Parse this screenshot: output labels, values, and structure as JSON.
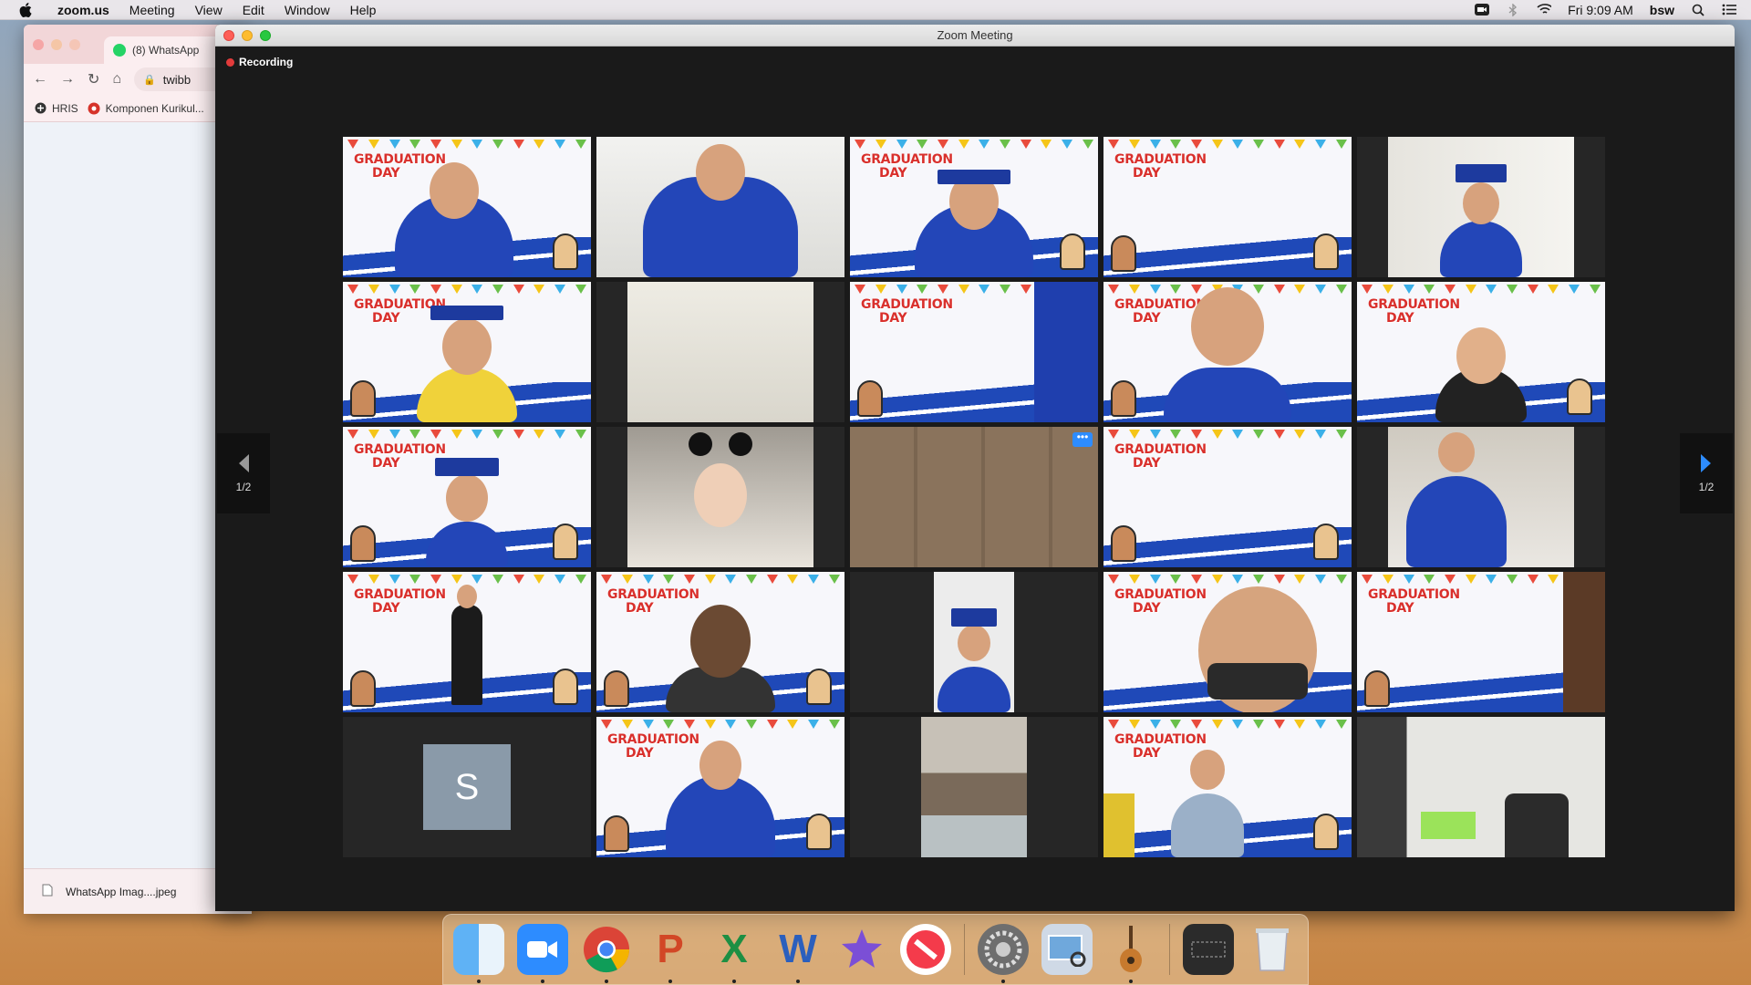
{
  "menubar": {
    "app_name": "zoom.us",
    "menus": [
      "Meeting",
      "View",
      "Edit",
      "Window",
      "Help"
    ],
    "clock": "Fri 9:09 AM",
    "user": "bsw"
  },
  "chrome": {
    "tab_title": "(8) WhatsApp",
    "address": "twibb",
    "bookmarks": [
      "HRIS",
      "Komponen Kurikul..."
    ],
    "download_file": "WhatsApp Imag....jpeg"
  },
  "zoom": {
    "window_title": "Zoom Meeting",
    "recording_label": "Recording",
    "page_indicator_left": "1/2",
    "page_indicator_right": "1/2",
    "graduation_text_1": "GRADUATION",
    "graduation_text_2": "DAY",
    "avatar_initial": "S",
    "more_label": "•••"
  },
  "dock": {
    "apps": [
      "finder",
      "zoom",
      "chrome",
      "powerpoint",
      "excel",
      "word",
      "imovie",
      "news",
      "system-preferences",
      "preview",
      "garageband",
      "screenshot",
      "trash"
    ]
  }
}
